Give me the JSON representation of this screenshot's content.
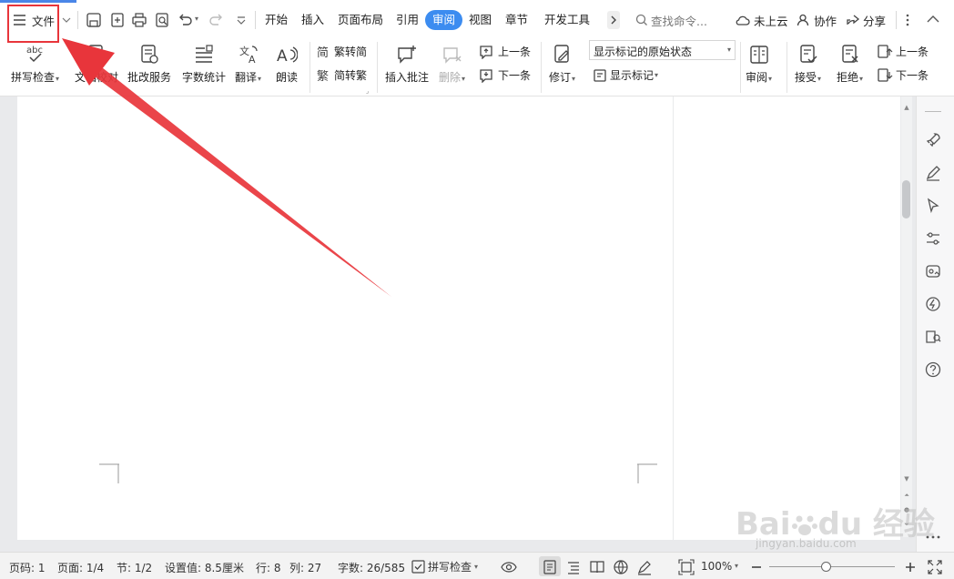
{
  "menubar": {
    "file_label": "文件",
    "tabs": [
      "开始",
      "插入",
      "页面布局",
      "引用",
      "审阅",
      "视图",
      "章节",
      "开发工具"
    ],
    "active_tab": "审阅",
    "search_placeholder": "查找命令...",
    "cloud_label": "未上云",
    "collab_label": "协作",
    "share_label": "分享"
  },
  "ribbon": {
    "spell_check": "拼写检查",
    "doc_compare": "文档校对",
    "correction_service": "批改服务",
    "word_count": "字数统计",
    "translate": "翻译",
    "read_aloud": "朗读",
    "trad_to_simp": "繁转简",
    "simp_to_trad": "简转繁",
    "insert_comment": "插入批注",
    "delete": "删除",
    "prev_comment": "上一条",
    "next_comment": "下一条",
    "track_changes": "修订",
    "markup_select": "显示标记的原始状态",
    "show_markup": "显示标记",
    "review": "审阅",
    "accept": "接受",
    "reject": "拒绝",
    "prev_change": "上一条",
    "next_change": "下一条"
  },
  "status": {
    "page_no": "页码: 1",
    "pages": "页面: 1/4",
    "section": "节: 1/2",
    "setting": "设置值: 8.5厘米",
    "row": "行: 8",
    "col": "列: 27",
    "word_count": "字数: 26/585",
    "spell_check": "拼写检查",
    "zoom": "100%",
    "zoom_fraction": 0.46
  },
  "watermark": {
    "brand": "Bai",
    "brand2": "du",
    "cn": "经验",
    "url": "jingyan.baidu.com"
  },
  "colors": {
    "accent": "#3c8cf0",
    "highlight_box": "#e8353b",
    "arrow": "#e8353b"
  }
}
